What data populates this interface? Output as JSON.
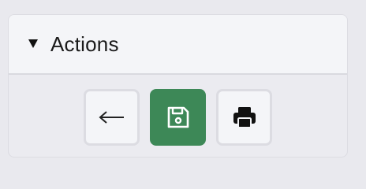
{
  "panel": {
    "title": "Actions",
    "expanded": true,
    "caret_icon": "triangle-down-icon"
  },
  "toolbar": {
    "buttons": [
      {
        "id": "back",
        "icon": "arrow-left-icon",
        "style": "neutral"
      },
      {
        "id": "save",
        "icon": "floppy-disk-icon",
        "style": "primary"
      },
      {
        "id": "print",
        "icon": "printer-icon",
        "style": "neutral"
      }
    ]
  },
  "colors": {
    "primary": "#3d8857",
    "neutral_bg": "#f4f5f8",
    "border": "#dcdce2",
    "page_bg": "#e9e9ee"
  }
}
